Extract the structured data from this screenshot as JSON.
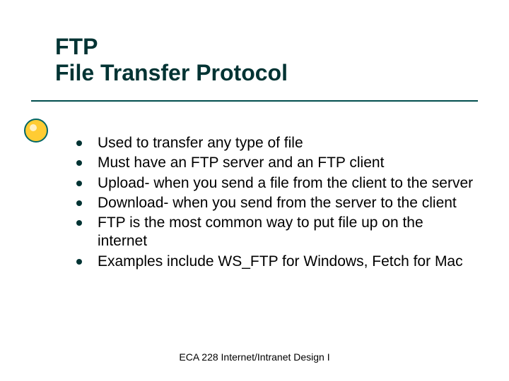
{
  "title": {
    "line1": "FTP",
    "line2": "File Transfer Protocol"
  },
  "bullets": [
    "Used to transfer any type of file",
    "Must have an FTP server and an FTP client",
    "Upload- when you send a file from the client to the server",
    "Download- when you send from the server to the client",
    "FTP is the most common way to put file up on the internet",
    "Examples include WS_FTP for Windows, Fetch for Mac"
  ],
  "footer": "ECA 228  Internet/Intranet Design I"
}
